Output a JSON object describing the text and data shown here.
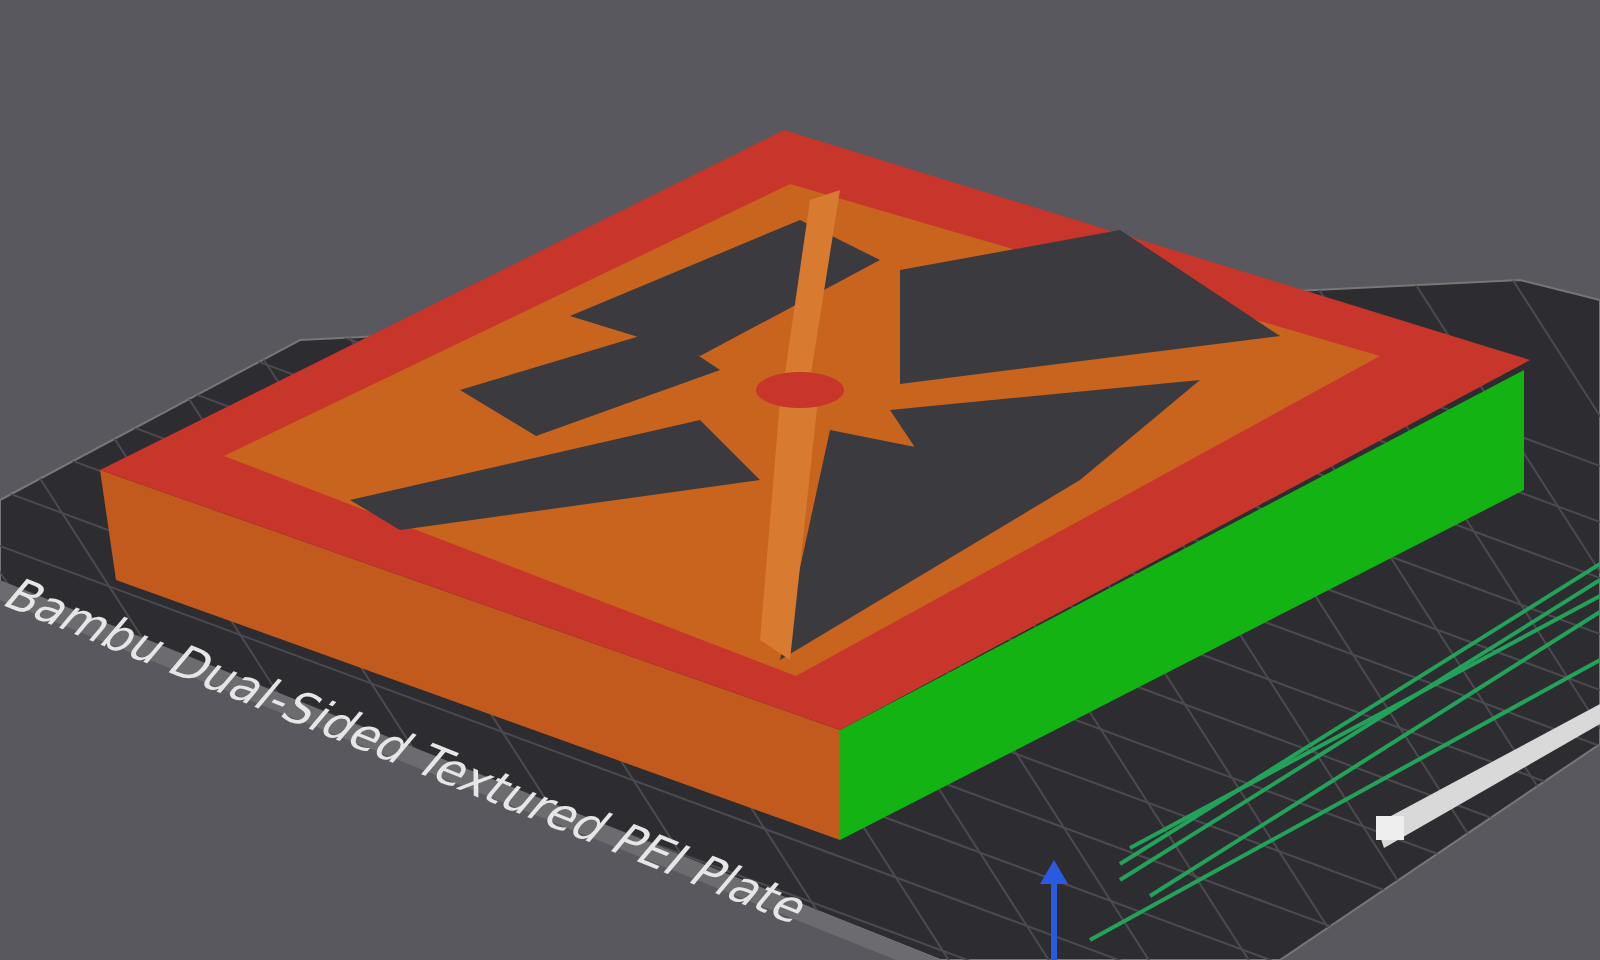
{
  "viewport": {
    "plate_label": "Bambu Dual-Sided Textured PEI Plate"
  }
}
